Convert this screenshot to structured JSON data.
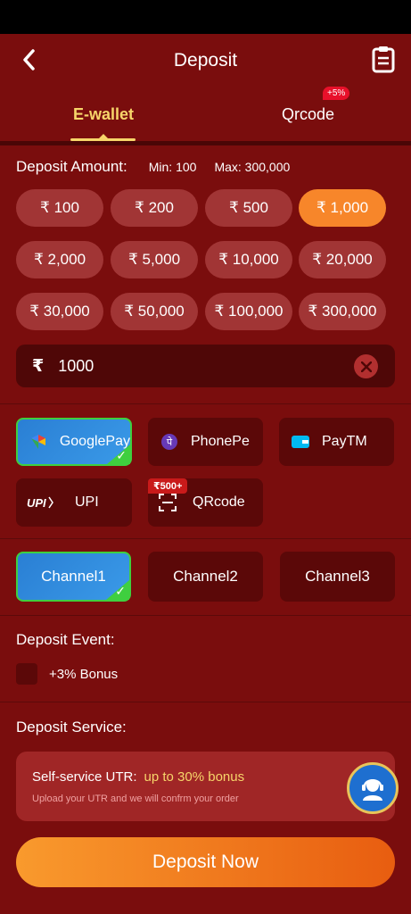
{
  "header": {
    "title": "Deposit"
  },
  "tabs": [
    {
      "label": "E-wallet",
      "active": true
    },
    {
      "label": "Qrcode",
      "badge": "+5%"
    }
  ],
  "amount": {
    "label": "Deposit Amount:",
    "min": "Min: 100",
    "max": "Max: 300,000",
    "options": [
      "₹ 100",
      "₹ 200",
      "₹ 500",
      "₹ 1,000",
      "₹ 2,000",
      "₹ 5,000",
      "₹ 10,000",
      "₹ 20,000",
      "₹ 30,000",
      "₹ 50,000",
      "₹ 100,000",
      "₹ 300,000"
    ],
    "selected": "₹ 1,000",
    "currency": "₹",
    "value": "1000"
  },
  "methods": [
    {
      "label": "GooglePay",
      "icon": "google-pay-icon",
      "selected": true
    },
    {
      "label": "PhonePe",
      "icon": "phonepe-icon"
    },
    {
      "label": "PayTM",
      "icon": "paytm-icon"
    },
    {
      "label": "UPI",
      "icon": "upi-icon"
    },
    {
      "label": "QRcode",
      "icon": "qr-scan-icon",
      "badge": "₹500+"
    }
  ],
  "channels": [
    {
      "label": "Channel1",
      "selected": true
    },
    {
      "label": "Channel2"
    },
    {
      "label": "Channel3"
    }
  ],
  "event": {
    "label": "Deposit Event:",
    "bonus": "+3% Bonus"
  },
  "service": {
    "label": "Deposit Service:",
    "title": "Self-service UTR:",
    "bonus": "up to 30% bonus",
    "subtitle": "Upload your UTR and we will confrm your order"
  },
  "submit": {
    "label": "Deposit Now"
  },
  "colors": {
    "background": "#7a0d0d",
    "accent": "#f7862a",
    "highlight": "#f7d56a",
    "selected_border": "#3fcf3f"
  }
}
